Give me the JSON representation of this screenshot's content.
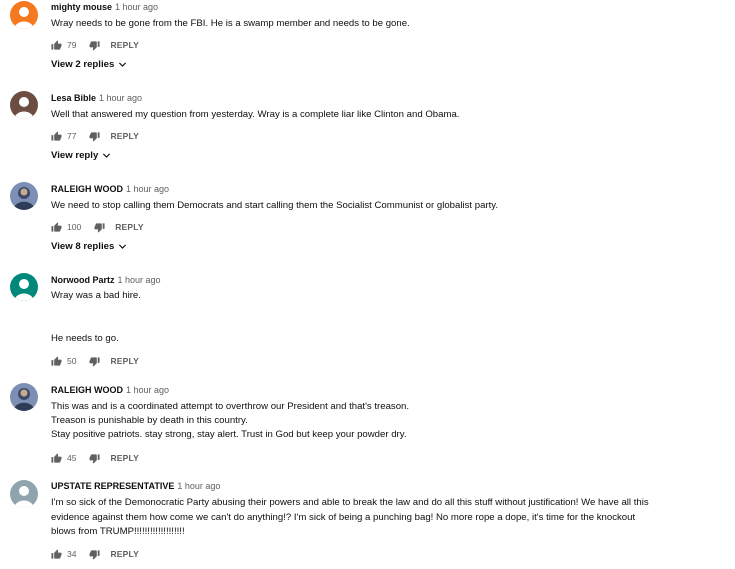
{
  "comments": [
    {
      "author": "mighty mouse",
      "time": "1 hour ago",
      "text": "Wray needs to be gone from the FBI. He is a swamp member and needs to be gone.",
      "likes": "79",
      "reply_label": "REPLY",
      "replies_label": "View 2 replies",
      "avatar_color": "#f4791f"
    },
    {
      "author": "Lesa Bible",
      "time": "1 hour ago",
      "text": "Well that answered my question from yesterday.  Wray is a complete liar like Clinton and Obama.",
      "likes": "77",
      "reply_label": "REPLY",
      "replies_label": "View reply",
      "avatar_color": "#6d4c41"
    },
    {
      "author": "RALEIGH WOOD",
      "time": "1 hour ago",
      "text": "We need to stop calling them Democrats and start calling them the Socialist Communist or globalist party.",
      "likes": "100",
      "reply_label": "REPLY",
      "replies_label": "View 8 replies",
      "avatar_color": "#7e8fb5"
    },
    {
      "author": "Norwood Partz",
      "time": "1 hour ago",
      "text": "Wray was a bad hire.\n\n\nHe needs to go.",
      "likes": "50",
      "reply_label": "REPLY",
      "avatar_color": "#00897b"
    },
    {
      "author": "RALEIGH WOOD",
      "time": "1 hour ago",
      "text": "This was and is a coordinated attempt to overthrow our President and that's treason.\n Treason is punishable by death in this country.\nStay positive patriots. stay strong, stay alert.  Trust in God but keep your powder dry.",
      "likes": "45",
      "reply_label": "REPLY",
      "avatar_color": "#7e8fb5"
    },
    {
      "author": "UPSTATE REPRESENTATIVE",
      "time": "1 hour ago",
      "text": "I'm so sick of the Demonocratic Party abusing their powers and able to break the law and do all this stuff without justification!  We have all this\nevidence against them how come we can't do anything!?  I'm sick of being a punching bag!  No more rope a dope, it's time for the knockout\nblows from TRUMP!!!!!!!!!!!!!!!!!!!",
      "likes": "34",
      "reply_label": "REPLY",
      "avatar_color": "#90a4ae"
    }
  ]
}
